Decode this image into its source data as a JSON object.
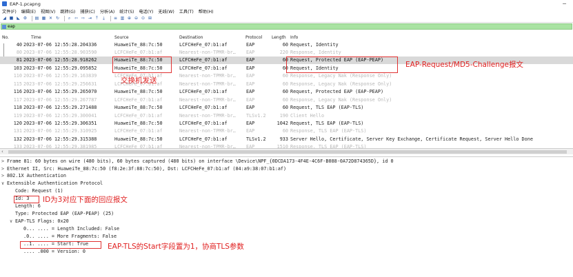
{
  "window": {
    "title": "EAP-1.pcapng",
    "minimize": "─"
  },
  "menu": [
    "文件(F)",
    "编辑(E)",
    "视图(V)",
    "跳转(G)",
    "捕获(C)",
    "分析(A)",
    "统计(S)",
    "电话(Y)",
    "无线(W)",
    "工具(T)",
    "帮助(H)"
  ],
  "filter": {
    "value": "eap"
  },
  "columns": [
    "No.",
    "Time",
    "Source",
    "Destination",
    "Protocol",
    "Length",
    "Info"
  ],
  "packets": [
    {
      "no": "40",
      "time": "2023-07-06 12:55:28.204336",
      "src": "HuaweiTe_88:7c:50",
      "dst": "LCFCHeFe_07:b1:af",
      "proto": "EAP",
      "len": "60",
      "info": "Request, Identity",
      "style": "dark"
    },
    {
      "no": "80",
      "time": "2023-07-06 12:55:28.903590",
      "src": "LCFCHeFe_07:b1:af",
      "dst": "Nearest-non-TPMR-br…",
      "proto": "EAP",
      "len": "220",
      "info": "Response, Identity",
      "style": "gray"
    },
    {
      "no": "81",
      "time": "2023-07-06 12:55:28.918262",
      "src": "HuaweiTe_88:7c:50",
      "dst": "LCFCHeFe_07:b1:af",
      "proto": "EAP",
      "len": "60",
      "info": "Request, Protected EAP (EAP-PEAP)",
      "style": "sel"
    },
    {
      "no": "103",
      "time": "2023-07-06 12:55:29.095852",
      "src": "HuaweiTe_88:7c:50",
      "dst": "LCFCHeFe_07:b1:af",
      "proto": "EAP",
      "len": "60",
      "info": "Request, Identity",
      "style": "dark"
    },
    {
      "no": "110",
      "time": "2023-07-06 12:55:29.163839",
      "src": "LCFCHeFe_07:b1:af",
      "dst": "Nearest-non-TPMR-br…",
      "proto": "EAP",
      "len": "60",
      "info": "Response, Legacy Nak (Response Only)",
      "style": "gray"
    },
    {
      "no": "115",
      "time": "2023-07-06 12:55:29.256631",
      "src": "LCFCHeFe_07:b1:af",
      "dst": "Nearest-non-TPMR-br…",
      "proto": "EAP",
      "len": "60",
      "info": "Response, Legacy Nak (Response Only)",
      "style": "gray"
    },
    {
      "no": "116",
      "time": "2023-07-06 12:55:29.265070",
      "src": "HuaweiTe_88:7c:50",
      "dst": "LCFCHeFe_07:b1:af",
      "proto": "EAP",
      "len": "60",
      "info": "Request, Protected EAP (EAP-PEAP)",
      "style": "dark"
    },
    {
      "no": "117",
      "time": "2023-07-06 12:55:29.267787",
      "src": "LCFCHeFe_07:b1:af",
      "dst": "Nearest-non-TPMR-br…",
      "proto": "EAP",
      "len": "60",
      "info": "Response, Legacy Nak (Response Only)",
      "style": "gray"
    },
    {
      "no": "118",
      "time": "2023-07-06 12:55:29.271488",
      "src": "HuaweiTe_88:7c:50",
      "dst": "LCFCHeFe_07:b1:af",
      "proto": "EAP",
      "len": "60",
      "info": "Request, TLS EAP (EAP-TLS)",
      "style": "dark"
    },
    {
      "no": "119",
      "time": "2023-07-06 12:55:29.300041",
      "src": "LCFCHeFe_07:b1:af",
      "dst": "Nearest-non-TPMR-br…",
      "proto": "TLSv1.2",
      "len": "190",
      "info": "Client Hello",
      "style": "gray"
    },
    {
      "no": "120",
      "time": "2023-07-06 12:55:29.306351",
      "src": "HuaweiTe_88:7c:50",
      "dst": "LCFCHeFe_07:b1:af",
      "proto": "EAP",
      "len": "1042",
      "info": "Request, TLS EAP (EAP-TLS)",
      "style": "dark"
    },
    {
      "no": "131",
      "time": "2023-07-06 12:55:29.310925",
      "src": "LCFCHeFe_07:b1:af",
      "dst": "Nearest-non-TPMR-br…",
      "proto": "EAP",
      "len": "60",
      "info": "Response, TLS EAP (EAP-TLS)",
      "style": "gray"
    },
    {
      "no": "132",
      "time": "2023-07-06 12:55:29.315388",
      "src": "HuaweiTe_88:7c:50",
      "dst": "LCFCHeFe_07:b1:af",
      "proto": "TLSv1.2",
      "len": "933",
      "info": "Server Hello, Certificate, Server Key Exchange, Certificate Request, Server Hello Done",
      "style": "dark"
    },
    {
      "no": "133",
      "time": "2023-07-06 12:55:29.381985",
      "src": "LCFCHeFe_07:b1:af",
      "dst": "Nearest-non-TPMR-br…",
      "proto": "EAP",
      "len": "1510",
      "info": "Response, TLS EAP (EAP-TLS)",
      "style": "gray"
    }
  ],
  "details": [
    {
      "exp": ">",
      "text": "Frame 81: 60 bytes on wire (480 bits), 60 bytes captured (480 bits) on interface \\Device\\NPF_{0DCDA173-4F4E-4C6F-B088-0A72D874365D}, id 0"
    },
    {
      "exp": ">",
      "text": "Ethernet II, Src: HuaweiTe_88:7c:50 (f8:2e:3f:88:7c:50), Dst: LCFCHeFe_07:b1:af (84:a9:38:07:b1:af)"
    },
    {
      "exp": ">",
      "text": "802.1X Authentication"
    },
    {
      "exp": "∨",
      "text": "Extensible Authentication Protocol"
    },
    {
      "exp": "",
      "text": "Code: Request (1)"
    },
    {
      "exp": "",
      "text": "Id: 3"
    },
    {
      "exp": "",
      "text": "Length: 6"
    },
    {
      "exp": "",
      "text": "Type: Protected EAP (EAP-PEAP) (25)"
    },
    {
      "exp": "∨",
      "text": "EAP-TLS Flags: 0x20"
    },
    {
      "exp": "",
      "text": "0... .... = Length Included: False"
    },
    {
      "exp": "",
      "text": ".0.. .... = More Fragments: False"
    },
    {
      "exp": "",
      "text": "..1. .... = Start: True"
    },
    {
      "exp": "",
      "text": ".... .000 = Version: 0"
    }
  ],
  "annotations": {
    "md5_challenge": "EAP-Request/MD5-Challenge报文",
    "switch_send": "交换机发送",
    "id_note": "ID为3对应下面的回应报文",
    "start_note": "EAP-TLS的Start字段置为1，协商TLS参数"
  },
  "colors": {
    "annotation": "#e02020",
    "filter_bg": "#a9e3a2",
    "selected_row": "#d9d9d9"
  }
}
